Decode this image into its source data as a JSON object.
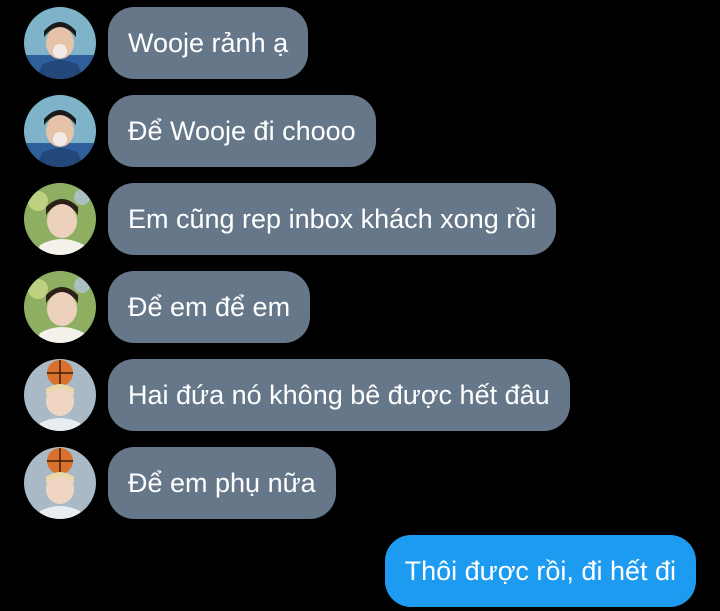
{
  "conversation": {
    "messages": [
      {
        "sender": "user-a",
        "direction": "incoming",
        "avatar": "avatar-boy-bubble-gum",
        "text": "Wooje rảnh ạ"
      },
      {
        "sender": "user-a",
        "direction": "incoming",
        "avatar": "avatar-boy-bubble-gum",
        "text": "Để Wooje đi chooo"
      },
      {
        "sender": "user-b",
        "direction": "incoming",
        "avatar": "avatar-boy-nature",
        "text": "Em cũng rep inbox khách xong rồi"
      },
      {
        "sender": "user-b",
        "direction": "incoming",
        "avatar": "avatar-boy-nature",
        "text": "Để em để em"
      },
      {
        "sender": "user-c",
        "direction": "incoming",
        "avatar": "avatar-boy-basketball",
        "text": "Hai đứa nó không bê được hết đâu"
      },
      {
        "sender": "user-c",
        "direction": "incoming",
        "avatar": "avatar-boy-basketball",
        "text": "Để em phụ nữa"
      },
      {
        "sender": "me",
        "direction": "outgoing",
        "text": "Thôi được rồi, đi hết đi"
      }
    ]
  },
  "colors": {
    "background": "#000000",
    "incoming_bubble": "#66778a",
    "outgoing_bubble": "#1d9bf0",
    "text": "#ffffff"
  }
}
